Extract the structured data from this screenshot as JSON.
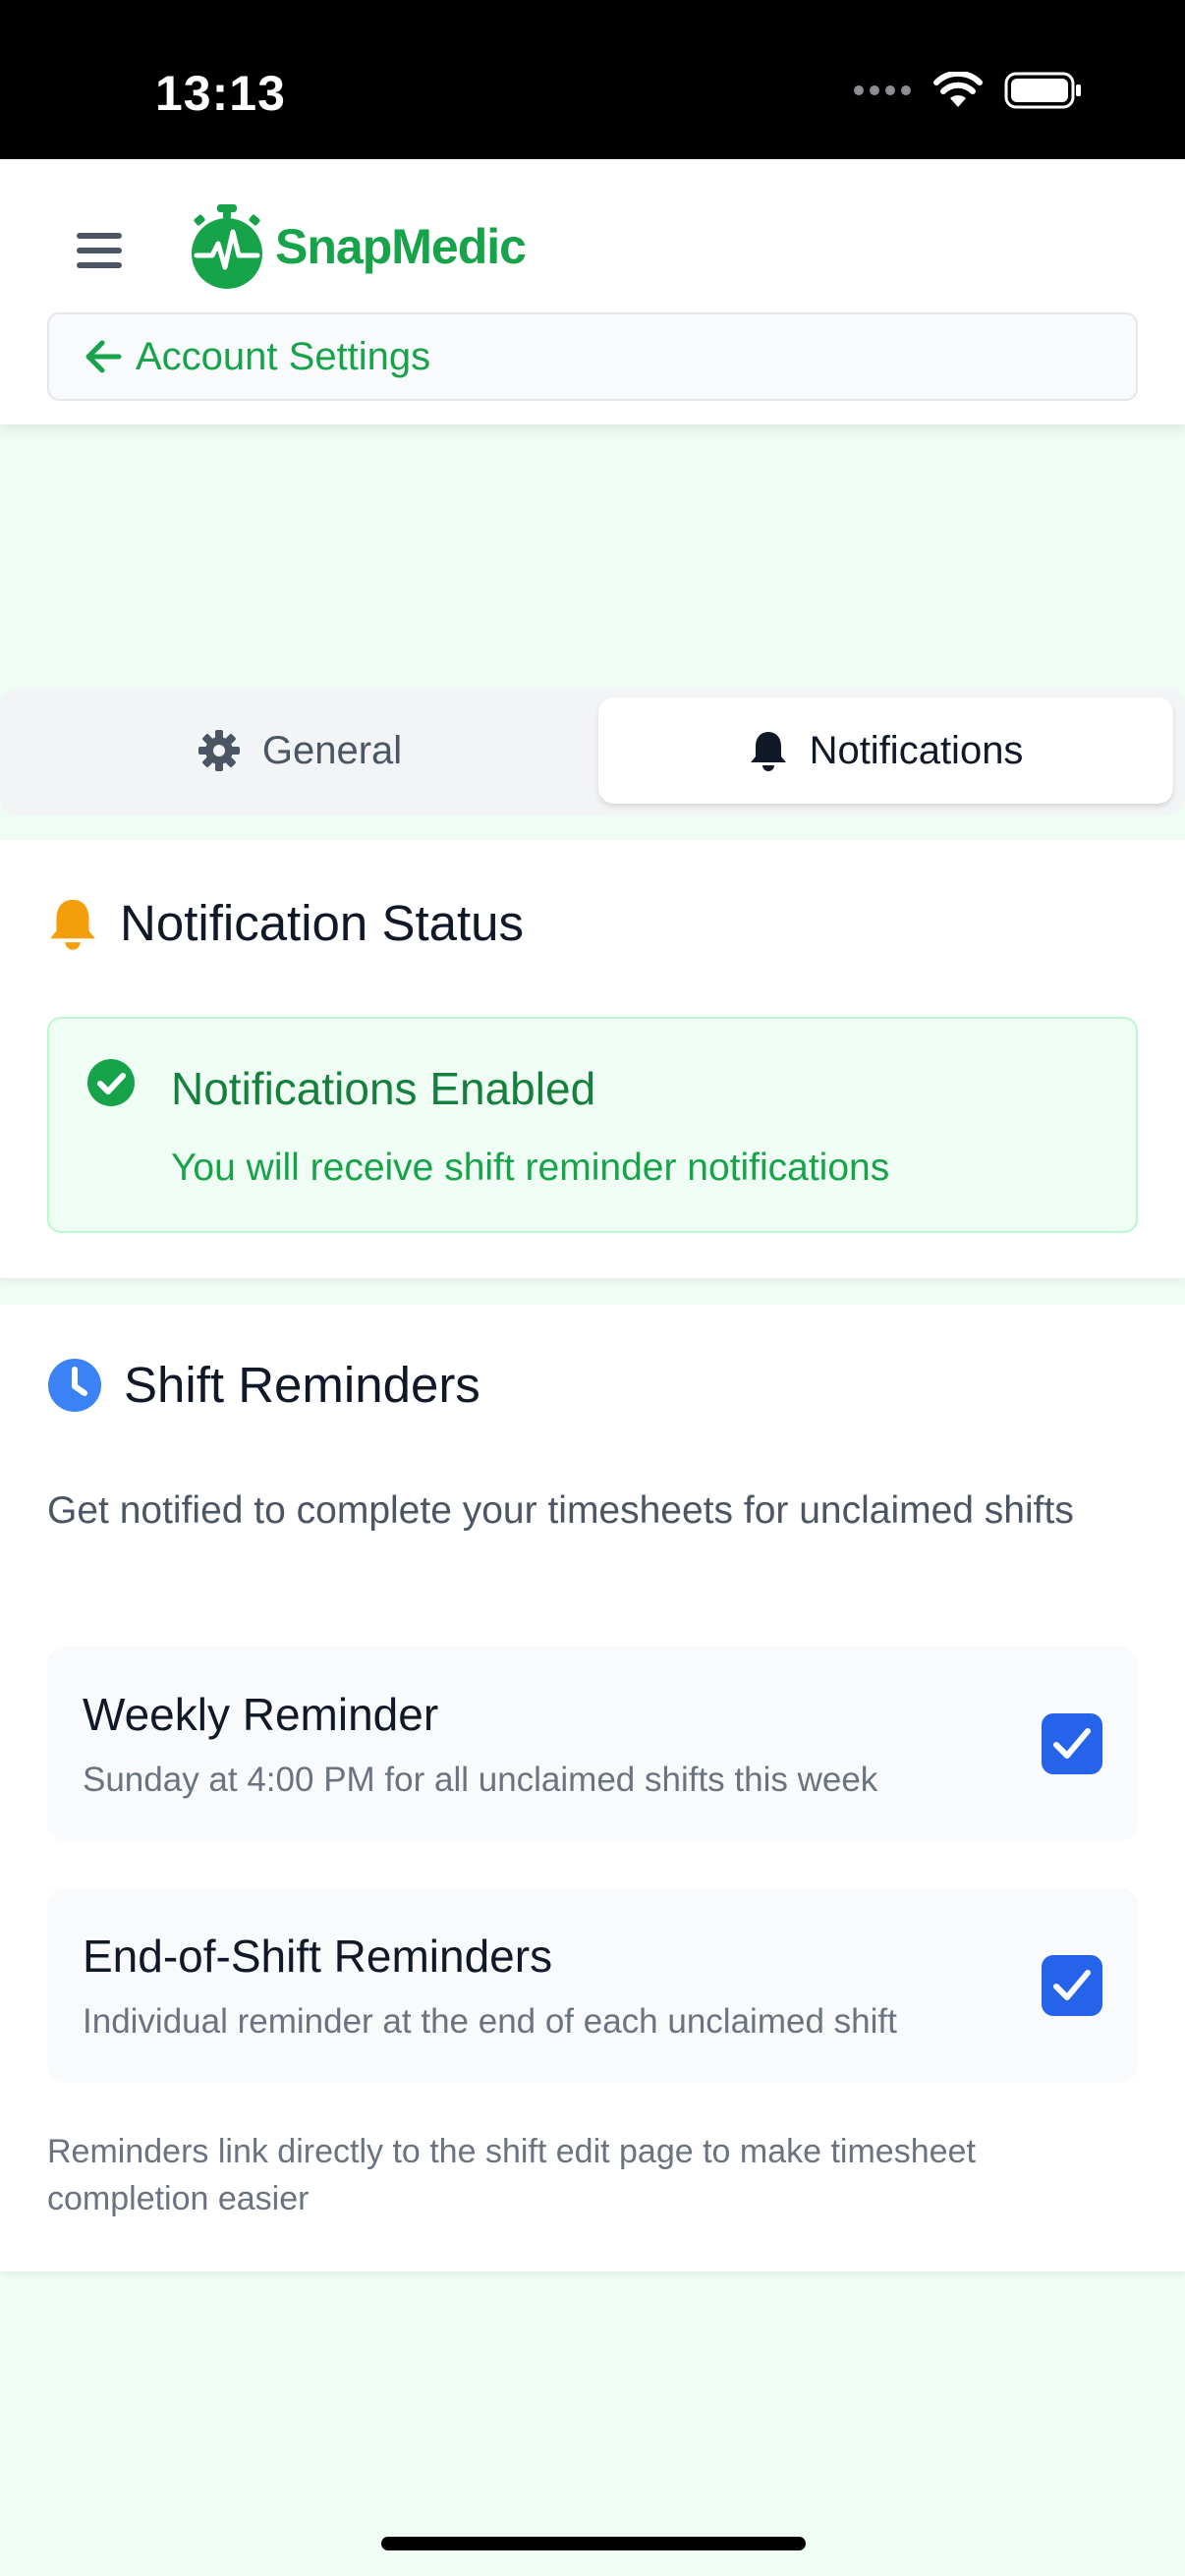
{
  "status_bar": {
    "time": "13:13"
  },
  "header": {
    "app_name": "SnapMedic",
    "back_label": "Account Settings"
  },
  "tabs": [
    {
      "label": "General",
      "icon": "gear-icon",
      "active": false
    },
    {
      "label": "Notifications",
      "icon": "bell-icon",
      "active": true
    }
  ],
  "notification_status": {
    "title": "Notification Status",
    "enabled_title": "Notifications Enabled",
    "enabled_message": "You will receive shift reminder notifications"
  },
  "shift_reminders": {
    "title": "Shift Reminders",
    "description": "Get notified to complete your timesheets for unclaimed shifts",
    "items": [
      {
        "title": "Weekly Reminder",
        "subtitle": "Sunday at 4:00 PM for all unclaimed shifts this week",
        "checked": true
      },
      {
        "title": "End-of-Shift Reminders",
        "subtitle": "Individual reminder at the end of each unclaimed shift",
        "checked": true
      }
    ],
    "footnote": "Reminders link directly to the shift edit page to make timesheet completion easier"
  },
  "colors": {
    "brand_green": "#16a34a",
    "accent_blue": "#2563eb",
    "bell_yellow": "#f59e0b",
    "page_background": "#f0fdf4"
  }
}
